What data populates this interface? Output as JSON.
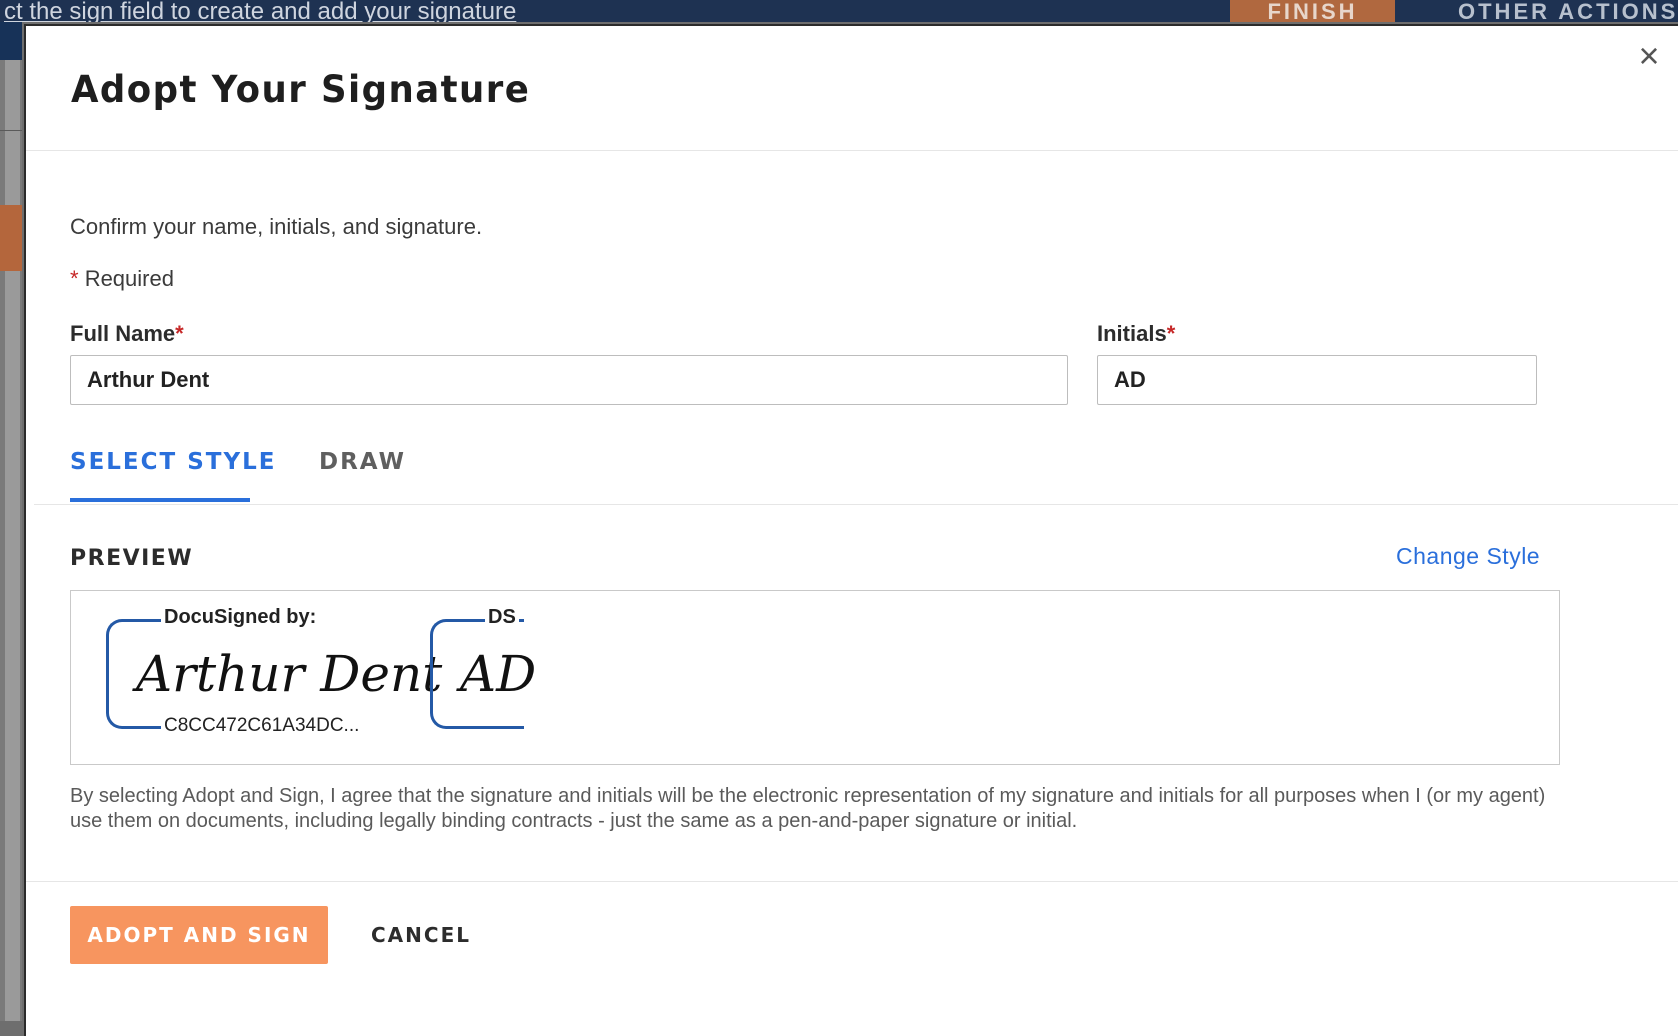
{
  "background": {
    "instruction_text": "ct the sign field to create and add your signature",
    "finish_label": "FINISH",
    "other_actions_label": "OTHER ACTIONS"
  },
  "modal": {
    "title": "Adopt Your Signature",
    "close_symbol": "×",
    "confirm_text": "Confirm your name, initials, and signature.",
    "required_marker": "*",
    "required_text": "Required",
    "full_name": {
      "label": "Full Name",
      "value": "Arthur Dent"
    },
    "initials": {
      "label": "Initials",
      "value": "AD"
    },
    "tabs": [
      {
        "label": "SELECT STYLE",
        "active": true
      },
      {
        "label": "DRAW",
        "active": false
      }
    ],
    "preview": {
      "label": "PREVIEW",
      "change_style": "Change Style",
      "signature": {
        "header": "DocuSigned by:",
        "script": "Arthur Dent",
        "footer": "C8CC472C61A34DC..."
      },
      "initials_stamp": {
        "header": "DS",
        "script": "AD"
      }
    },
    "legal_text": "By selecting Adopt and Sign, I agree that the signature and initials will be the electronic representation of my signature and initials for all purposes when I (or my agent) use them on documents, including legally binding contracts - just the same as a pen-and-paper signature or initial.",
    "buttons": {
      "adopt": "ADOPT AND SIGN",
      "cancel": "CANCEL"
    }
  },
  "colors": {
    "accent_blue": "#2a6fdb",
    "adopt_orange": "#f7955f",
    "signature_bracket": "#2459a6",
    "required_red": "#c62828"
  }
}
